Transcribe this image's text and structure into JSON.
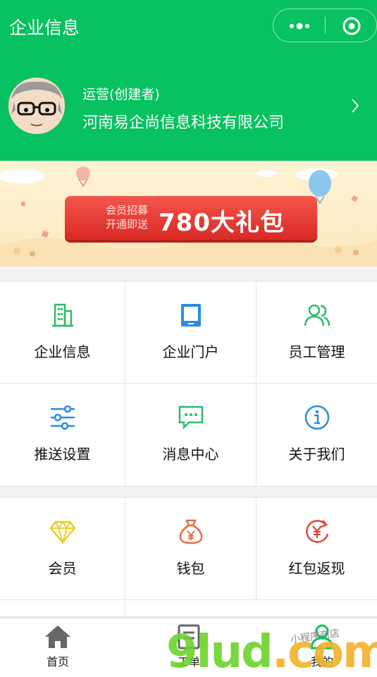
{
  "header": {
    "title": "企业信息"
  },
  "user": {
    "role": "运营(创建者)",
    "company": "河南易企尚信息科技有限公司"
  },
  "banner": {
    "line1": "会员招募",
    "line2": "开通即送",
    "big": "780大礼包"
  },
  "menu1": [
    {
      "label": "企业信息",
      "icon": "building-icon",
      "color": "#2ebb69"
    },
    {
      "label": "企业门户",
      "icon": "tablet-icon",
      "color": "#2a8de0"
    },
    {
      "label": "员工管理",
      "icon": "users-icon",
      "color": "#2ebb69"
    },
    {
      "label": "推送设置",
      "icon": "sliders-icon",
      "color": "#2a8de0"
    },
    {
      "label": "消息中心",
      "icon": "message-icon",
      "color": "#2ebb69"
    },
    {
      "label": "关于我们",
      "icon": "info-icon",
      "color": "#2a8de0"
    }
  ],
  "menu2": [
    {
      "label": "会员",
      "icon": "diamond-icon",
      "color": "#e8cf2a"
    },
    {
      "label": "钱包",
      "icon": "money-bag-icon",
      "color": "#e96a45"
    },
    {
      "label": "红包返现",
      "icon": "yen-return-icon",
      "color": "#e0483a"
    }
  ],
  "tabbar": [
    {
      "label": "首页",
      "icon": "home-icon"
    },
    {
      "label": "工单",
      "icon": "order-icon"
    },
    {
      "label": "我的",
      "icon": "profile-icon"
    }
  ],
  "watermark": {
    "brand": "9lud",
    "suffix": ".com",
    "note": "小程序商店"
  },
  "colors": {
    "brand_green": "#08c160",
    "accent_red": "#d92a25"
  }
}
